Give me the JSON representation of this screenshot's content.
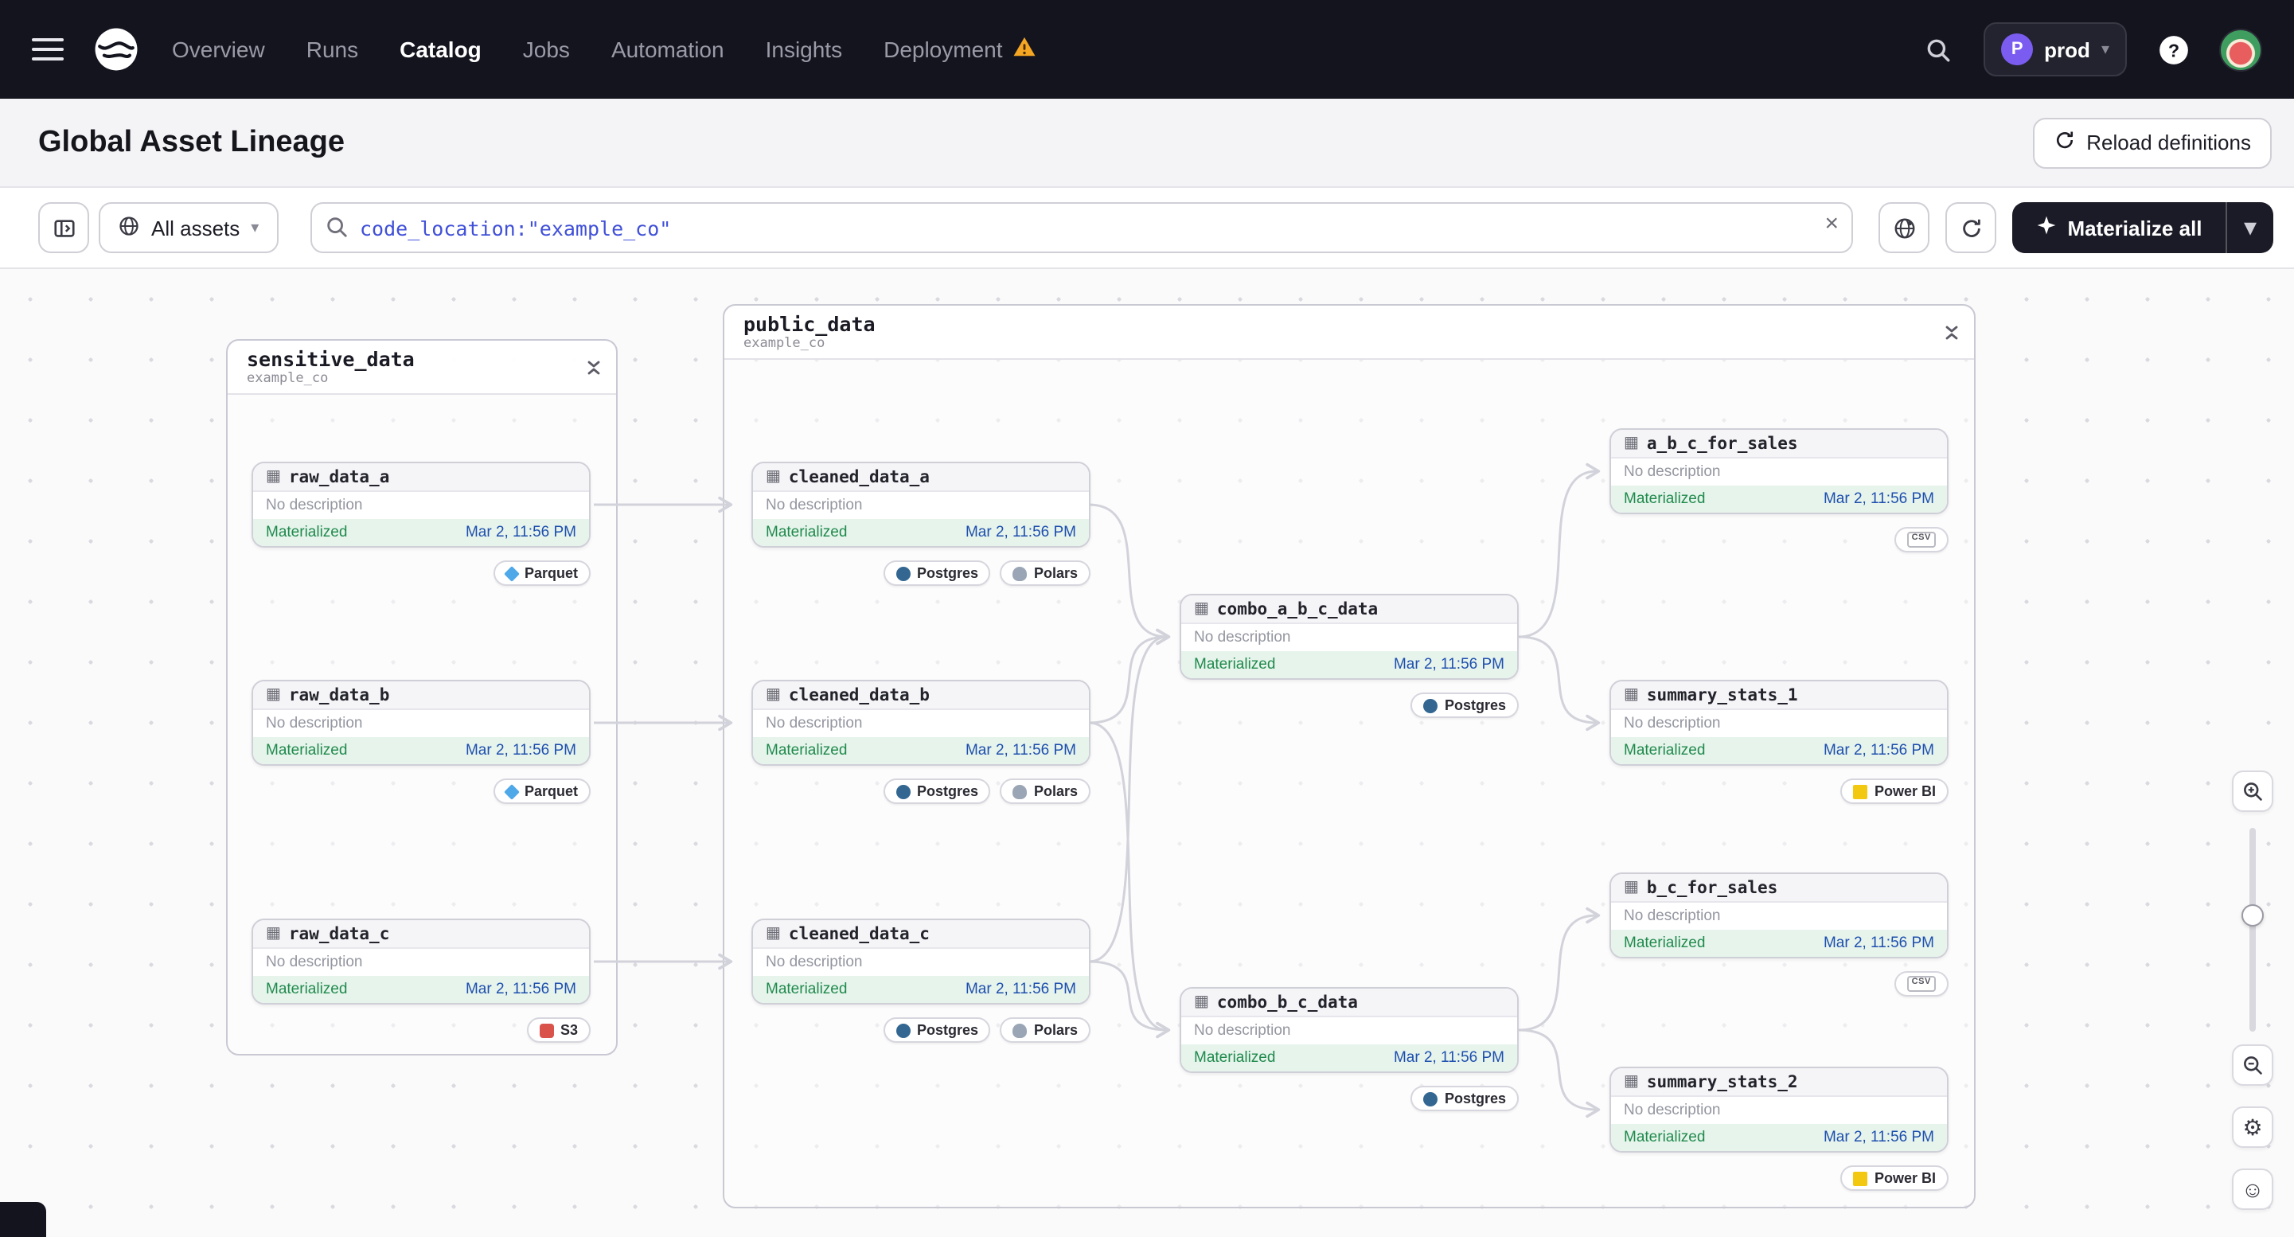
{
  "nav": {
    "menu_items": [
      {
        "label": "Overview"
      },
      {
        "label": "Runs"
      },
      {
        "label": "Catalog"
      },
      {
        "label": "Jobs"
      },
      {
        "label": "Automation"
      },
      {
        "label": "Insights"
      },
      {
        "label": "Deployment"
      }
    ],
    "active_item": "Catalog",
    "env": {
      "initial": "P",
      "name": "prod"
    }
  },
  "header": {
    "title": "Global Asset Lineage",
    "reload_label": "Reload definitions"
  },
  "toolbar": {
    "scope_label": "All assets",
    "search_value": "code_location:\"example_co\"",
    "materialize_label": "Materialize all"
  },
  "canvas": {
    "groups": [
      {
        "name": "sensitive_data",
        "code_location": "example_co"
      },
      {
        "name": "public_data",
        "code_location": "example_co"
      }
    ]
  },
  "nodes": [
    {
      "title": "raw_data_a",
      "description": "No description",
      "status": "Materialized",
      "timestamp": "Mar 2, 11:56 PM",
      "tags": [
        {
          "icon": "parquet",
          "label": "Parquet"
        }
      ]
    },
    {
      "title": "raw_data_b",
      "description": "No description",
      "status": "Materialized",
      "timestamp": "Mar 2, 11:56 PM",
      "tags": [
        {
          "icon": "parquet",
          "label": "Parquet"
        }
      ]
    },
    {
      "title": "raw_data_c",
      "description": "No description",
      "status": "Materialized",
      "timestamp": "Mar 2, 11:56 PM",
      "tags": [
        {
          "icon": "s3",
          "label": "S3"
        }
      ]
    },
    {
      "title": "cleaned_data_a",
      "description": "No description",
      "status": "Materialized",
      "timestamp": "Mar 2, 11:56 PM",
      "tags": [
        {
          "icon": "postgres",
          "label": "Postgres"
        },
        {
          "icon": "polars",
          "label": "Polars"
        }
      ]
    },
    {
      "title": "cleaned_data_b",
      "description": "No description",
      "status": "Materialized",
      "timestamp": "Mar 2, 11:56 PM",
      "tags": [
        {
          "icon": "postgres",
          "label": "Postgres"
        },
        {
          "icon": "polars",
          "label": "Polars"
        }
      ]
    },
    {
      "title": "cleaned_data_c",
      "description": "No description",
      "status": "Materialized",
      "timestamp": "Mar 2, 11:56 PM",
      "tags": [
        {
          "icon": "postgres",
          "label": "Postgres"
        },
        {
          "icon": "polars",
          "label": "Polars"
        }
      ]
    },
    {
      "title": "combo_a_b_c_data",
      "description": "No description",
      "status": "Materialized",
      "timestamp": "Mar 2, 11:56 PM",
      "tags": [
        {
          "icon": "postgres",
          "label": "Postgres"
        }
      ]
    },
    {
      "title": "combo_b_c_data",
      "description": "No description",
      "status": "Materialized",
      "timestamp": "Mar 2, 11:56 PM",
      "tags": [
        {
          "icon": "postgres",
          "label": "Postgres"
        }
      ]
    },
    {
      "title": "a_b_c_for_sales",
      "description": "No description",
      "status": "Materialized",
      "timestamp": "Mar 2, 11:56 PM",
      "tags": [
        {
          "icon": "csv",
          "icon_text": "CSV",
          "label": ""
        }
      ]
    },
    {
      "title": "summary_stats_1",
      "description": "No description",
      "status": "Materialized",
      "timestamp": "Mar 2, 11:56 PM",
      "tags": [
        {
          "icon": "powerbi",
          "label": "Power BI"
        }
      ]
    },
    {
      "title": "b_c_for_sales",
      "description": "No description",
      "status": "Materialized",
      "timestamp": "Mar 2, 11:56 PM",
      "tags": [
        {
          "icon": "csv",
          "icon_text": "CSV",
          "label": ""
        }
      ]
    },
    {
      "title": "summary_stats_2",
      "description": "No description",
      "status": "Materialized",
      "timestamp": "Mar 2, 11:56 PM",
      "tags": [
        {
          "icon": "powerbi",
          "label": "Power BI"
        }
      ]
    }
  ],
  "colors": {
    "nav_bg": "#14141f",
    "accent_blue": "#4050d8",
    "materialized_green": "#1f8a4c",
    "materialized_bg": "#e7f4ec",
    "timestamp_blue": "#1e4fae",
    "warning_orange": "#f5a623"
  }
}
